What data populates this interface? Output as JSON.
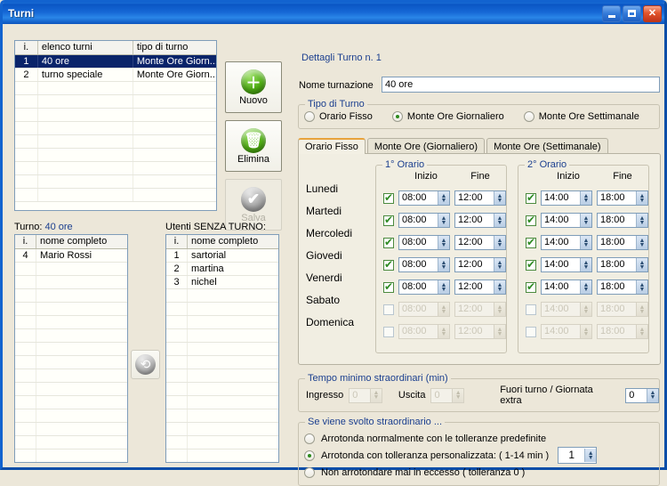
{
  "window": {
    "title": "Turni",
    "buttons": {
      "minimize": "–",
      "maximize": "□",
      "close": "✕"
    }
  },
  "turni_list": {
    "columns": [
      "i.",
      "elenco turni",
      "tipo di turno"
    ],
    "rows": [
      {
        "i": "1",
        "nome": "40 ore",
        "tipo": "Monte Ore Giorn...",
        "selected": true
      },
      {
        "i": "2",
        "nome": "turno speciale",
        "tipo": "Monte Ore Giorn...",
        "selected": false
      }
    ]
  },
  "actions": {
    "nuovo": "Nuovo",
    "elimina": "Elimina",
    "salva": "Salva",
    "nuovo_icon": "plus-circle-icon",
    "elimina_icon": "trash-circle-icon",
    "salva_icon": "check-circle-icon",
    "move_icon": "transfer-arrows-icon"
  },
  "turno_panel": {
    "label_prefix": "Turno:",
    "label_value": "40 ore",
    "columns": [
      "i.",
      "nome completo"
    ],
    "rows": [
      {
        "i": "4",
        "nome": "Mario Rossi"
      }
    ]
  },
  "utenti_panel": {
    "label": "Utenti SENZA TURNO:",
    "columns": [
      "i.",
      "nome completo"
    ],
    "rows": [
      {
        "i": "1",
        "nome": "sartorial"
      },
      {
        "i": "2",
        "nome": "martina"
      },
      {
        "i": "3",
        "nome": "nichel"
      }
    ]
  },
  "dettagli": {
    "legend": "Dettagli Turno n. 1",
    "nome_label": "Nome turnazione",
    "nome_value": "40 ore",
    "tipo_legend": "Tipo di Turno",
    "tipo_options": [
      {
        "label": "Orario Fisso",
        "selected": false
      },
      {
        "label": "Monte Ore Giornaliero",
        "selected": true
      },
      {
        "label": "Monte Ore Settimanale",
        "selected": false
      }
    ]
  },
  "tabs": [
    {
      "label": "Orario Fisso",
      "active": true
    },
    {
      "label": "Monte Ore (Giornaliero)",
      "active": false
    },
    {
      "label": "Monte Ore (Settimanale)",
      "active": false
    }
  ],
  "schedule": {
    "group1_legend": "1° Orario",
    "group2_legend": "2° Orario",
    "head_inizio": "Inizio",
    "head_fine": "Fine",
    "days": [
      {
        "name": "Lunedi",
        "g1": {
          "on": true,
          "inizio": "08:00",
          "fine": "12:00"
        },
        "g2": {
          "on": true,
          "inizio": "14:00",
          "fine": "18:00"
        }
      },
      {
        "name": "Martedi",
        "g1": {
          "on": true,
          "inizio": "08:00",
          "fine": "12:00"
        },
        "g2": {
          "on": true,
          "inizio": "14:00",
          "fine": "18:00"
        }
      },
      {
        "name": "Mercoledi",
        "g1": {
          "on": true,
          "inizio": "08:00",
          "fine": "12:00"
        },
        "g2": {
          "on": true,
          "inizio": "14:00",
          "fine": "18:00"
        }
      },
      {
        "name": "Giovedi",
        "g1": {
          "on": true,
          "inizio": "08:00",
          "fine": "12:00"
        },
        "g2": {
          "on": true,
          "inizio": "14:00",
          "fine": "18:00"
        }
      },
      {
        "name": "Venerdi",
        "g1": {
          "on": true,
          "inizio": "08:00",
          "fine": "12:00"
        },
        "g2": {
          "on": true,
          "inizio": "14:00",
          "fine": "18:00"
        }
      },
      {
        "name": "Sabato",
        "g1": {
          "on": false,
          "inizio": "08:00",
          "fine": "12:00"
        },
        "g2": {
          "on": false,
          "inizio": "14:00",
          "fine": "18:00"
        }
      },
      {
        "name": "Domenica",
        "g1": {
          "on": false,
          "inizio": "08:00",
          "fine": "12:00"
        },
        "g2": {
          "on": false,
          "inizio": "14:00",
          "fine": "18:00"
        }
      }
    ]
  },
  "tempo_minimo": {
    "legend": "Tempo minimo straordinari (min)",
    "ingresso_label": "Ingresso",
    "ingresso_value": "0",
    "ingresso_disabled": true,
    "uscita_label": "Uscita",
    "uscita_value": "0",
    "uscita_disabled": true,
    "fuori_label": "Fuori turno / Giornata extra",
    "fuori_value": "0"
  },
  "straordinario": {
    "legend": "Se viene svolto straordinario ...",
    "options": [
      {
        "label": "Arrotonda normalmente con le tolleranze predefinite",
        "selected": false
      },
      {
        "label": "Arrotonda con tolleranza personalizzata: ( 1-14 min )",
        "selected": true,
        "spin_value": "1"
      },
      {
        "label": "Non arrotondare mai in eccesso ( tolleranza 0 )",
        "selected": false
      }
    ]
  },
  "colors": {
    "titlebar": "#0a56c4",
    "window_bg": "#ece7d9",
    "selection": "#0a246a",
    "legend_text": "#1b3f8f",
    "tab_accent": "#e8a33d",
    "green_icon": "#4fae14"
  }
}
